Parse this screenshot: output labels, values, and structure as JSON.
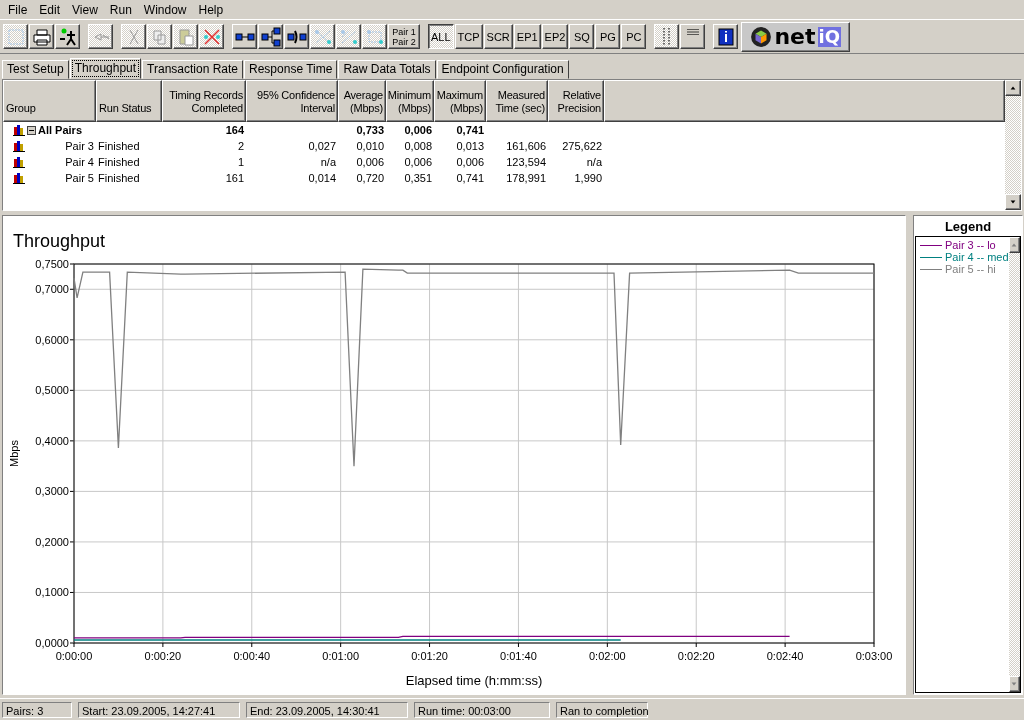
{
  "menu": [
    "File",
    "Edit",
    "View",
    "Run",
    "Window",
    "Help"
  ],
  "toolbar": [
    {
      "kind": "icon",
      "disabled": true
    },
    {
      "kind": "icon",
      "disabled": false
    },
    {
      "kind": "icon",
      "disabled": false
    },
    {
      "kind": "sep"
    },
    {
      "kind": "icon",
      "disabled": true
    },
    {
      "kind": "sep"
    },
    {
      "kind": "icon",
      "disabled": true
    },
    {
      "kind": "icon",
      "disabled": true
    },
    {
      "kind": "icon",
      "disabled": true
    },
    {
      "kind": "icon",
      "disabled": true
    },
    {
      "kind": "sep"
    },
    {
      "kind": "icon",
      "disabled": false
    },
    {
      "kind": "icon",
      "disabled": false
    },
    {
      "kind": "icon",
      "disabled": false
    },
    {
      "kind": "icon",
      "disabled": true
    },
    {
      "kind": "icon",
      "disabled": true
    },
    {
      "kind": "icon",
      "disabled": true
    },
    {
      "kind": "text",
      "label": "Pair 1 Pair 2",
      "selected": false
    },
    {
      "kind": "sep"
    },
    {
      "kind": "text",
      "label": "ALL",
      "selected": true
    },
    {
      "kind": "text",
      "label": "TCP",
      "selected": false
    },
    {
      "kind": "text",
      "label": "SCR",
      "selected": false
    },
    {
      "kind": "text",
      "label": "EP1",
      "selected": false
    },
    {
      "kind": "text",
      "label": "EP2",
      "selected": false
    },
    {
      "kind": "text",
      "label": "SQ",
      "selected": false
    },
    {
      "kind": "text",
      "label": "PG",
      "selected": false
    },
    {
      "kind": "text",
      "label": "PC",
      "selected": false
    },
    {
      "kind": "sep"
    },
    {
      "kind": "icon",
      "disabled": true
    },
    {
      "kind": "icon",
      "disabled": false
    },
    {
      "kind": "sep"
    },
    {
      "kind": "icon",
      "disabled": false
    },
    {
      "kind": "logo",
      "text": "net",
      "accent": "iQ"
    }
  ],
  "tabs": [
    {
      "label": "Test Setup",
      "selected": false
    },
    {
      "label": "Throughput",
      "selected": true
    },
    {
      "label": "Transaction Rate",
      "selected": false
    },
    {
      "label": "Response Time",
      "selected": false
    },
    {
      "label": "Raw Data Totals",
      "selected": false
    },
    {
      "label": "Endpoint Configuration",
      "selected": false
    }
  ],
  "table": {
    "columns": [
      "Group",
      "Run Status",
      "Timing Records Completed",
      "95% Confidence Interval",
      "Average (Mbps)",
      "Minimum (Mbps)",
      "Maximum (Mbps)",
      "Measured Time (sec)",
      "Relative Precision"
    ],
    "rows": [
      {
        "expanded": true,
        "cells": [
          "All Pairs",
          "",
          "164",
          "",
          "0,733",
          "0,006",
          "0,741",
          "",
          ""
        ],
        "children": [
          {
            "cells": [
              "Pair 3",
              "Finished",
              "2",
              "0,027",
              "0,010",
              "0,008",
              "0,013",
              "161,606",
              "275,622"
            ]
          },
          {
            "cells": [
              "Pair 4",
              "Finished",
              "1",
              "n/a",
              "0,006",
              "0,006",
              "0,006",
              "123,594",
              "n/a"
            ]
          },
          {
            "cells": [
              "Pair 5",
              "Finished",
              "161",
              "0,014",
              "0,720",
              "0,351",
              "0,741",
              "178,991",
              "1,990"
            ]
          }
        ]
      }
    ]
  },
  "chart": {
    "chart_data": {
      "type": "line",
      "title": "Throughput",
      "xlabel": "Elapsed time (h:mm:ss)",
      "ylabel": "Mbps",
      "x": [
        0,
        0.7,
        2,
        8,
        10,
        12,
        24,
        25,
        61,
        63,
        65,
        73,
        74,
        75,
        121.5,
        123,
        125,
        161,
        163,
        180
      ],
      "series": [
        {
          "name": "Pair 3 -- lo",
          "color": "#800080",
          "values": [
            0.01,
            0.01,
            0.01,
            0.01,
            0.01,
            0.01,
            0.01,
            0.011,
            0.011,
            0.011,
            0.011,
            0.011,
            0.013,
            0.013,
            0.013,
            0.013,
            0.013,
            0.013,
            null,
            null
          ]
        },
        {
          "name": "Pair 4 -- med",
          "color": "#008080",
          "values": [
            0.006,
            0.006,
            0.006,
            0.006,
            0.006,
            0.006,
            0.006,
            0.006,
            0.006,
            0.006,
            0.006,
            0.006,
            0.006,
            0.006,
            0.006,
            0.006,
            null,
            null,
            null,
            null
          ]
        },
        {
          "name": "Pair 5 -- hi",
          "color": "#808080",
          "values": [
            0.722,
            0.683,
            0.734,
            0.734,
            0.386,
            0.734,
            0.73,
            0.73,
            0.734,
            0.35,
            0.74,
            0.738,
            0.738,
            0.732,
            0.732,
            0.392,
            0.732,
            0.738,
            0.732,
            0.732
          ]
        }
      ],
      "xlim": [
        0,
        180
      ],
      "ylim": [
        0,
        0.75
      ],
      "grid": true,
      "xticks": [
        {
          "value": 0,
          "label": "0:00:00"
        },
        {
          "value": 20,
          "label": "0:00:20"
        },
        {
          "value": 40,
          "label": "0:00:40"
        },
        {
          "value": 60,
          "label": "0:01:00"
        },
        {
          "value": 80,
          "label": "0:01:20"
        },
        {
          "value": 100,
          "label": "0:01:40"
        },
        {
          "value": 120,
          "label": "0:02:00"
        },
        {
          "value": 140,
          "label": "0:02:20"
        },
        {
          "value": 160,
          "label": "0:02:40"
        },
        {
          "value": 180,
          "label": "0:03:00"
        }
      ],
      "yticks": [
        {
          "value": 0,
          "label": "0,0000"
        },
        {
          "value": 0.1,
          "label": "0,1000"
        },
        {
          "value": 0.2,
          "label": "0,2000"
        },
        {
          "value": 0.3,
          "label": "0,3000"
        },
        {
          "value": 0.4,
          "label": "0,4000"
        },
        {
          "value": 0.5,
          "label": "0,5000"
        },
        {
          "value": 0.6,
          "label": "0,6000"
        },
        {
          "value": 0.7,
          "label": "0,7000"
        },
        {
          "value": 0.75,
          "label": "0,7500"
        }
      ]
    }
  },
  "legend": {
    "title": "Legend"
  },
  "status_bar": [
    "Pairs: 3",
    "Start: 23.09.2005, 14:27:41",
    "End: 23.09.2005, 14:30:41",
    "Run time: 00:03:00",
    "Ran to completion"
  ]
}
